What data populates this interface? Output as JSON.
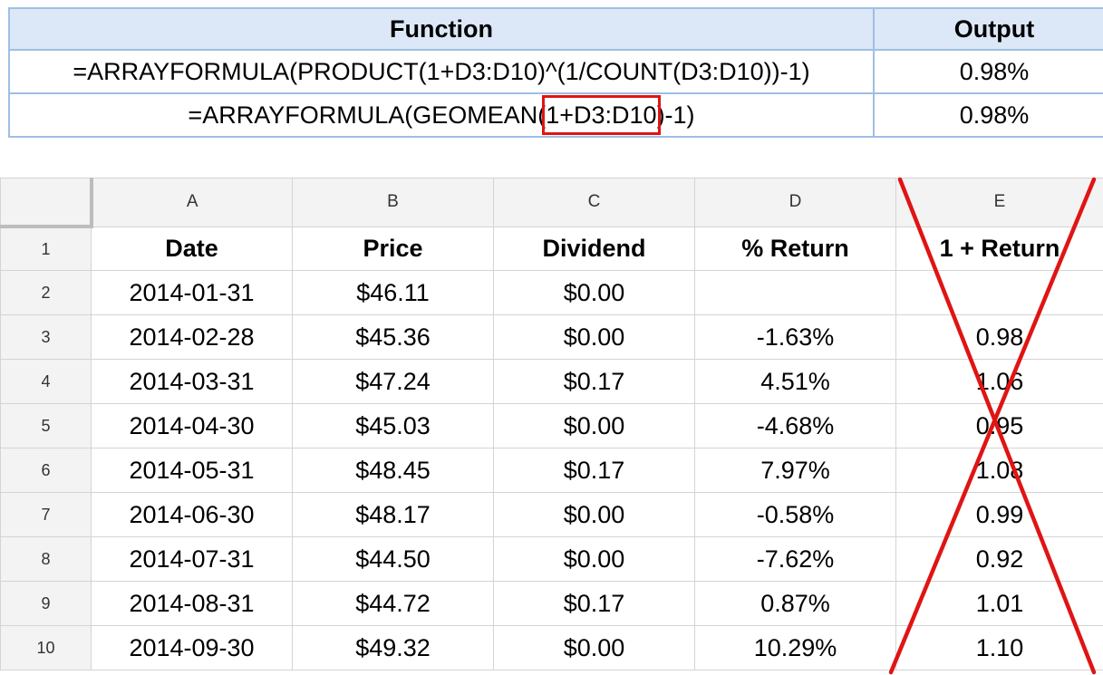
{
  "function_table": {
    "headers": {
      "function": "Function",
      "output": "Output"
    },
    "rows": [
      {
        "function": "=ARRAYFORMULA(PRODUCT(1+D3:D10)^(1/COUNT(D3:D10))-1)",
        "output": "0.98%"
      },
      {
        "function_prefix": "=ARRAYFORMULA(GEOMEAN(",
        "function_highlight": "1+D3:D10",
        "function_suffix": ")-1)",
        "output": "0.98%"
      }
    ],
    "highlight_color": "#e01414"
  },
  "sheet": {
    "column_letters": [
      "A",
      "B",
      "C",
      "D",
      "E"
    ],
    "header_row": {
      "row_num": "1",
      "cells": [
        "Date",
        "Price",
        "Dividend",
        "% Return",
        "1 + Return"
      ]
    },
    "rows": [
      {
        "row_num": "2",
        "cells": [
          "2014-01-31",
          "$46.11",
          "$0.00",
          "",
          ""
        ]
      },
      {
        "row_num": "3",
        "cells": [
          "2014-02-28",
          "$45.36",
          "$0.00",
          "-1.63%",
          "0.98"
        ]
      },
      {
        "row_num": "4",
        "cells": [
          "2014-03-31",
          "$47.24",
          "$0.17",
          "4.51%",
          "1.06"
        ]
      },
      {
        "row_num": "5",
        "cells": [
          "2014-04-30",
          "$45.03",
          "$0.00",
          "-4.68%",
          "0.95"
        ]
      },
      {
        "row_num": "6",
        "cells": [
          "2014-05-31",
          "$48.45",
          "$0.17",
          "7.97%",
          "1.08"
        ]
      },
      {
        "row_num": "7",
        "cells": [
          "2014-06-30",
          "$48.17",
          "$0.00",
          "-0.58%",
          "0.99"
        ]
      },
      {
        "row_num": "8",
        "cells": [
          "2014-07-31",
          "$44.50",
          "$0.00",
          "-7.62%",
          "0.92"
        ]
      },
      {
        "row_num": "9",
        "cells": [
          "2014-08-31",
          "$44.72",
          "$0.17",
          "0.87%",
          "1.01"
        ]
      },
      {
        "row_num": "10",
        "cells": [
          "2014-09-30",
          "$49.32",
          "$0.00",
          "10.29%",
          "1.10"
        ]
      }
    ],
    "crossed_out_column": "E",
    "cross_color": "#e01414"
  }
}
